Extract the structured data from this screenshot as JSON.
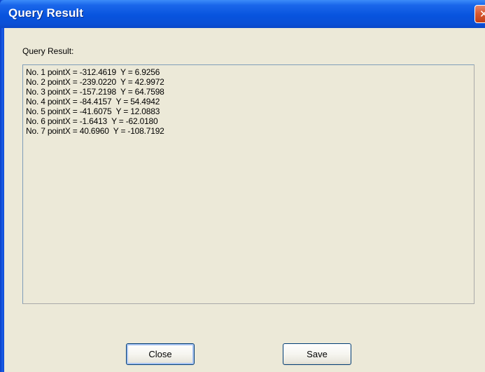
{
  "window": {
    "title": "Query Result",
    "close_glyph": "✕"
  },
  "main": {
    "label": "Query Result:",
    "lines": [
      "No. 1 pointX = -312.4619  Y = 6.9256",
      "No. 2 pointX = -239.0220  Y = 42.9972",
      "No. 3 pointX = -157.2198  Y = 64.7598",
      "No. 4 pointX = -84.4157  Y = 54.4942",
      "No. 5 pointX = -41.6075  Y = 12.0883",
      "No. 6 pointX = -1.6413  Y = -62.0180",
      "No. 7 pointX = 40.6960  Y = -108.7192"
    ]
  },
  "buttons": {
    "close_label": "Close",
    "save_label": "Save"
  },
  "colors": {
    "titlebar": "#0854de",
    "dialog_bg": "#ece9d8",
    "close_button": "#d6572f"
  }
}
